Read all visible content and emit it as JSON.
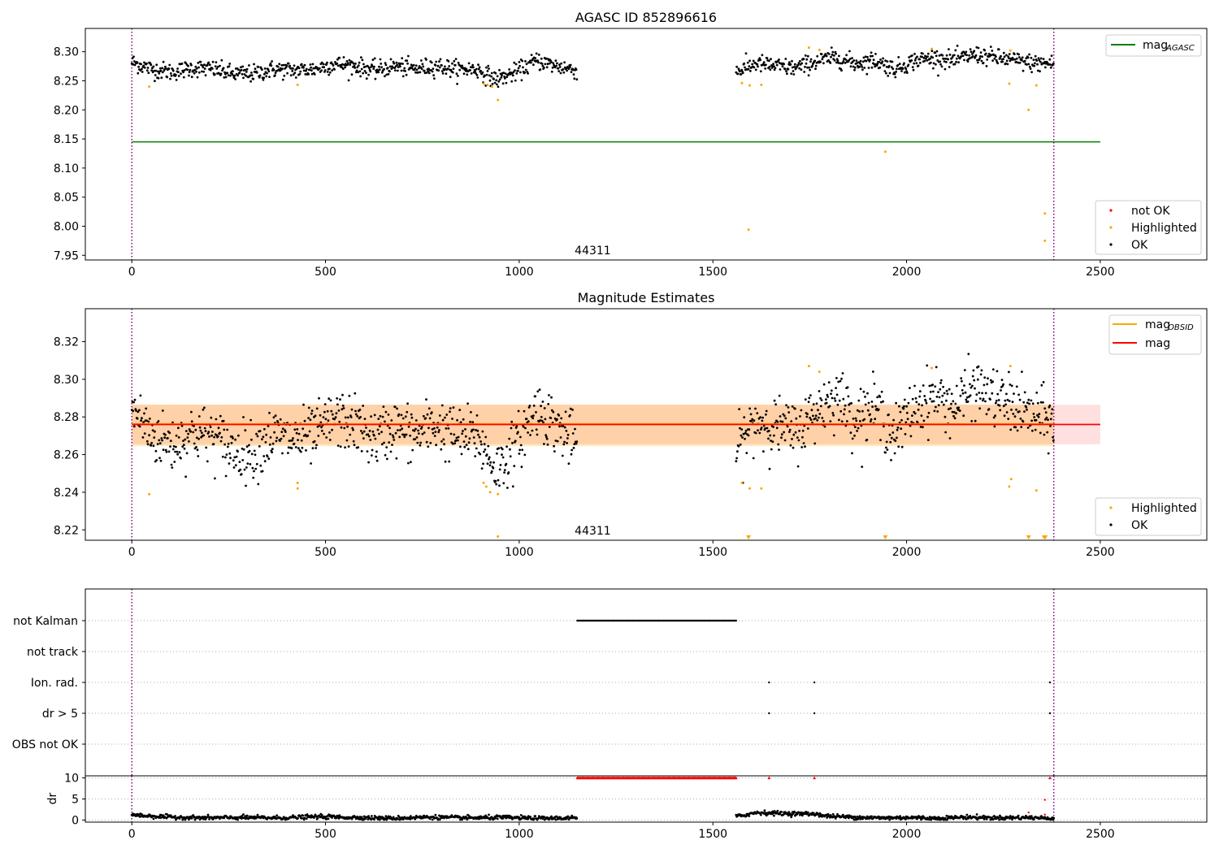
{
  "chart_data": [
    {
      "type": "scatter",
      "title": "AGASC ID 852896616",
      "xlim": [
        -120,
        2775
      ],
      "ylim": [
        7.942,
        8.34
      ],
      "xticks": [
        0,
        500,
        1000,
        1500,
        2000,
        2500
      ],
      "yticks": [
        7.95,
        8.0,
        8.05,
        8.1,
        8.15,
        8.2,
        8.25,
        8.3
      ],
      "ytick_labels": [
        "7.95",
        "8.00",
        "8.05",
        "8.10",
        "8.15",
        "8.20",
        "8.25",
        "8.30"
      ],
      "vlines": [
        0,
        2380
      ],
      "hlines": [
        {
          "series": "mag_AGASC",
          "y": 8.145,
          "x": [
            0,
            2500
          ],
          "color": "#008000"
        }
      ],
      "annotation": {
        "text": "44311",
        "x": 1190,
        "y": 7.952
      },
      "ok_segments": [
        {
          "x": [
            0,
            1150
          ],
          "y": [
            8.282,
            8.27,
            8.265,
            8.272,
            8.27,
            8.262,
            8.262,
            8.27,
            8.268,
            8.27,
            8.279,
            8.276,
            8.268,
            8.275,
            8.27,
            8.276,
            8.27,
            8.27,
            8.252,
            8.265,
            8.285,
            8.275,
            8.268
          ]
        },
        {
          "x": [
            1560,
            2380
          ],
          "y": [
            8.265,
            8.28,
            8.275,
            8.272,
            8.283,
            8.29,
            8.28,
            8.285,
            8.27,
            8.285,
            8.29,
            8.285,
            8.295,
            8.29,
            8.285,
            8.28,
            8.28
          ]
        }
      ],
      "highlighted": [
        [
          45,
          8.24
        ],
        [
          428,
          8.243
        ],
        [
          908,
          8.245
        ],
        [
          918,
          8.243
        ],
        [
          930,
          8.24
        ],
        [
          945,
          8.217
        ],
        [
          1575,
          8.246
        ],
        [
          1595,
          8.242
        ],
        [
          1625,
          8.243
        ],
        [
          1748,
          8.307
        ],
        [
          1775,
          8.303
        ],
        [
          1945,
          8.128
        ],
        [
          2065,
          8.305
        ],
        [
          2265,
          8.245
        ],
        [
          2268,
          8.302
        ],
        [
          2335,
          8.242
        ],
        [
          2315,
          8.2
        ],
        [
          1592,
          7.994
        ],
        [
          2357,
          8.022
        ],
        [
          2357,
          7.975
        ]
      ],
      "legend_top": [
        {
          "label_main": "mag",
          "label_sub": "AGASC",
          "color": "#008000"
        }
      ],
      "legend_bottom": [
        {
          "label": "not OK",
          "color": "#ff0000"
        },
        {
          "label": "Highlighted",
          "color": "#ffa500"
        },
        {
          "label": "OK",
          "color": "#000000"
        }
      ]
    },
    {
      "type": "scatter",
      "title": "Magnitude Estimates",
      "xlim": [
        -120,
        2775
      ],
      "ylim": [
        8.2145,
        8.3375
      ],
      "xticks": [
        0,
        500,
        1000,
        1500,
        2000,
        2500
      ],
      "yticks": [
        8.22,
        8.24,
        8.26,
        8.28,
        8.3,
        8.32
      ],
      "ytick_labels": [
        "8.22",
        "8.24",
        "8.26",
        "8.28",
        "8.30",
        "8.32"
      ],
      "vlines": [
        0,
        2380
      ],
      "band_obsid": {
        "x": [
          0,
          2380
        ],
        "y": [
          8.2645,
          8.2865
        ],
        "color": "#ffa500",
        "opacity": 0.25
      },
      "band_mag": {
        "x": [
          0,
          2500
        ],
        "y": [
          8.2655,
          8.2865
        ],
        "color": "#ff0000",
        "opacity": 0.12
      },
      "hlines": [
        {
          "series": "mag_OBSID",
          "y": 8.2763,
          "x": [
            0,
            2380
          ],
          "color": "#ffa500"
        },
        {
          "series": "mag",
          "y": 8.276,
          "x": [
            0,
            2500
          ],
          "color": "#ff0000"
        }
      ],
      "annotation": {
        "text": "44311",
        "x": 1190,
        "y": 8.2175
      },
      "ok_segments": [
        {
          "x": [
            0,
            1150
          ],
          "y": [
            8.285,
            8.27,
            8.265,
            8.272,
            8.27,
            8.262,
            8.262,
            8.27,
            8.268,
            8.27,
            8.279,
            8.276,
            8.268,
            8.275,
            8.27,
            8.276,
            8.27,
            8.27,
            8.252,
            8.265,
            8.285,
            8.275,
            8.265
          ]
        },
        {
          "x": [
            1560,
            2380
          ],
          "y": [
            8.262,
            8.278,
            8.275,
            8.272,
            8.283,
            8.292,
            8.28,
            8.285,
            8.27,
            8.285,
            8.292,
            8.285,
            8.296,
            8.29,
            8.286,
            8.28,
            8.278
          ]
        }
      ],
      "highlighted": [
        [
          45,
          8.239
        ],
        [
          428,
          8.245
        ],
        [
          428,
          8.242
        ],
        [
          908,
          8.245
        ],
        [
          915,
          8.243
        ],
        [
          925,
          8.24
        ],
        [
          945,
          8.239
        ],
        [
          945,
          8.2165
        ],
        [
          1575,
          8.245
        ],
        [
          1595,
          8.242
        ],
        [
          1625,
          8.242
        ],
        [
          1748,
          8.307
        ],
        [
          1775,
          8.304
        ],
        [
          2065,
          8.306
        ],
        [
          2265,
          8.243
        ],
        [
          2268,
          8.307
        ],
        [
          2270,
          8.247
        ],
        [
          2335,
          8.241
        ]
      ],
      "highlighted_clipped_x": [
        1592,
        1945,
        2315,
        2355,
        2358
      ],
      "legend_top": [
        {
          "label_main": "mag",
          "label_sub": "OBSID",
          "color": "#ffa500"
        },
        {
          "label_main": "mag",
          "label_sub": "",
          "color": "#ff0000"
        }
      ],
      "legend_bottom": [
        {
          "label": "Highlighted",
          "color": "#ffa500"
        },
        {
          "label": "OK",
          "color": "#000000"
        }
      ]
    },
    {
      "type": "scatter",
      "title": "",
      "xlim": [
        -120,
        2775
      ],
      "categories": [
        "not Kalman",
        "not track",
        "Ion. rad.",
        "dr > 5",
        "OBS not OK"
      ],
      "vlines": [
        0,
        2380
      ],
      "flags": {
        "not Kalman": {
          "ranges": [
            [
              1150,
              1560
            ]
          ],
          "points": []
        },
        "not track": {
          "ranges": [],
          "points": []
        },
        "Ion. rad.": {
          "ranges": [],
          "points": [
            1645,
            1762,
            2370
          ]
        },
        "dr > 5": {
          "ranges": [],
          "points": [
            1645,
            1762,
            2370
          ]
        },
        "OBS not OK": {
          "ranges": [],
          "points": []
        }
      }
    },
    {
      "type": "scatter",
      "title": "",
      "xlim": [
        -120,
        2775
      ],
      "ylim": [
        -0.5,
        10.5
      ],
      "ylabel": "dr",
      "xticks": [
        0,
        500,
        1000,
        1500,
        2000,
        2500
      ],
      "yticks": [
        0,
        5,
        10
      ],
      "ytick_labels": [
        "0",
        "5",
        "10"
      ],
      "vlines": [
        0,
        2380
      ],
      "ok_segments": [
        {
          "x": [
            0,
            1150
          ],
          "y": [
            1.2,
            0.7,
            0.5,
            0.6,
            0.5,
            0.8,
            0.6,
            0.4,
            0.7,
            0.5,
            0.6,
            0.4,
            0.5
          ]
        },
        {
          "x": [
            1560,
            1780
          ],
          "y": [
            0.8,
            1.8,
            1.6,
            1.5,
            1.4
          ]
        },
        {
          "x": [
            1780,
            2380
          ],
          "y": [
            1.0,
            0.7,
            0.5,
            0.6,
            0.4,
            0.7,
            0.5,
            0.6,
            0.4
          ]
        }
      ],
      "not_ok_range": {
        "x": [
          1150,
          1560
        ],
        "y": 10
      },
      "not_ok_points": [
        [
          1645,
          10
        ],
        [
          1762,
          10
        ],
        [
          2370,
          10
        ]
      ],
      "extra_points": [
        [
          2315,
          1.8
        ],
        [
          2357,
          4.8
        ],
        [
          2357,
          1.3
        ]
      ]
    }
  ]
}
